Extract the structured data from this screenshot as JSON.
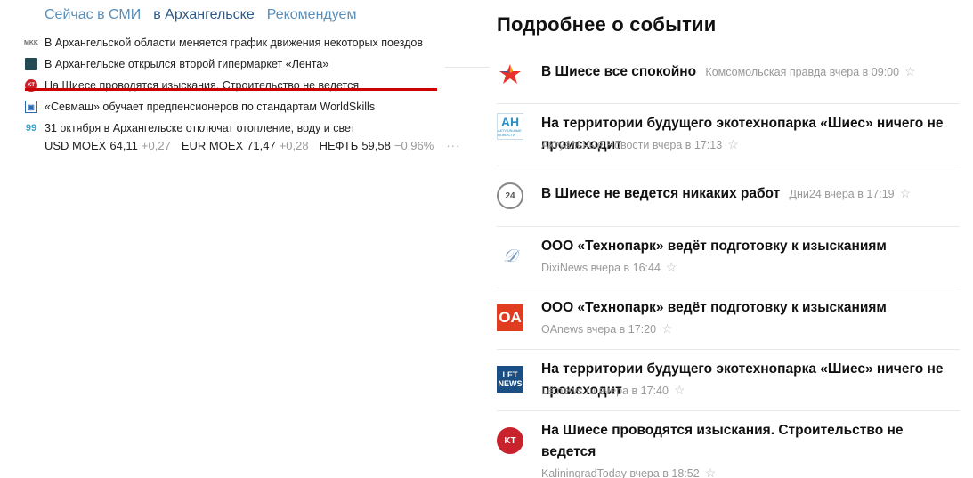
{
  "tabs": {
    "media": "Сейчас в СМИ",
    "region": "в Архангельске",
    "recommended": "Рекомендуем"
  },
  "news": [
    {
      "icon": "mkk",
      "text": "В Архангельской области меняется график движения некоторых поездов"
    },
    {
      "icon": "square-logo",
      "text": "В Архангельске открылся второй гипермаркет «Лента»"
    },
    {
      "icon": "kt",
      "text": "На Шиесе проводятся изыскания. Строительство не ведется"
    },
    {
      "icon": "doc",
      "text": "«Севмаш» обучает предпенсионеров по стандартам WorldSkills"
    },
    {
      "icon": "dd",
      "text": "31 октября в Архангельске отключат отопление, воду и свет"
    }
  ],
  "quotes": [
    {
      "name": "USD MOEX",
      "value": "64,11",
      "change": "+0,27"
    },
    {
      "name": "EUR MOEX",
      "value": "71,47",
      "change": "+0,28"
    },
    {
      "name": "НЕФТЬ",
      "value": "59,58",
      "change": "−0,96%"
    }
  ],
  "more_label": "···",
  "detail": {
    "title": "Подробнее о событии",
    "stories": [
      {
        "logo": "kp",
        "headline": "В Шиесе все спокойно",
        "source": "Комсомольская правда",
        "time": "вчера в 09:00"
      },
      {
        "logo": "ah",
        "logo_text": "АН",
        "logo_sub": "АКТУАЛЬНЫЕ НОВОСТИ",
        "headline": "На территории будущего экотехнопарка «Шиес» ничего не происходит",
        "source": "Актуальные Новости",
        "time": "вчера в 17:13"
      },
      {
        "logo": "dni24",
        "logo_text": "24",
        "headline": "В Шиесе не ведется никаких работ",
        "source": "Дни24",
        "time": "вчера в 17:19"
      },
      {
        "logo": "dixi",
        "logo_text": "𝒟",
        "headline": "ООО «Технопарк» ведёт подготовку к изысканиям",
        "source": "DixiNews",
        "time": "вчера в 16:44"
      },
      {
        "logo": "oa",
        "logo_text": "OA",
        "headline": "ООО «Технопарк» ведёт подготовку к изысканиям",
        "source": "OAnews",
        "time": "вчера в 17:20"
      },
      {
        "logo": "letnews",
        "logo_text": "LET",
        "logo_sub": "NEWS",
        "headline": "На территории будущего экотехнопарка «Шиес» ничего не происходит",
        "source": "Letnews.ru",
        "time": "вчера в 17:40"
      },
      {
        "logo": "kt",
        "logo_text": "KT",
        "headline": "На Шиесе проводятся изыскания. Строительство не ведется",
        "source": "KaliningradToday",
        "time": "вчера в 18:52"
      }
    ]
  },
  "star": "☆",
  "news_icons": {
    "mkk": "MKK",
    "kt": "KT",
    "doc": "▣",
    "dd": "99"
  },
  "colors": {
    "accent": "#cc0000",
    "link_light": "#5b8db5",
    "link_dark": "#2c5a8a",
    "meta": "#999999"
  }
}
